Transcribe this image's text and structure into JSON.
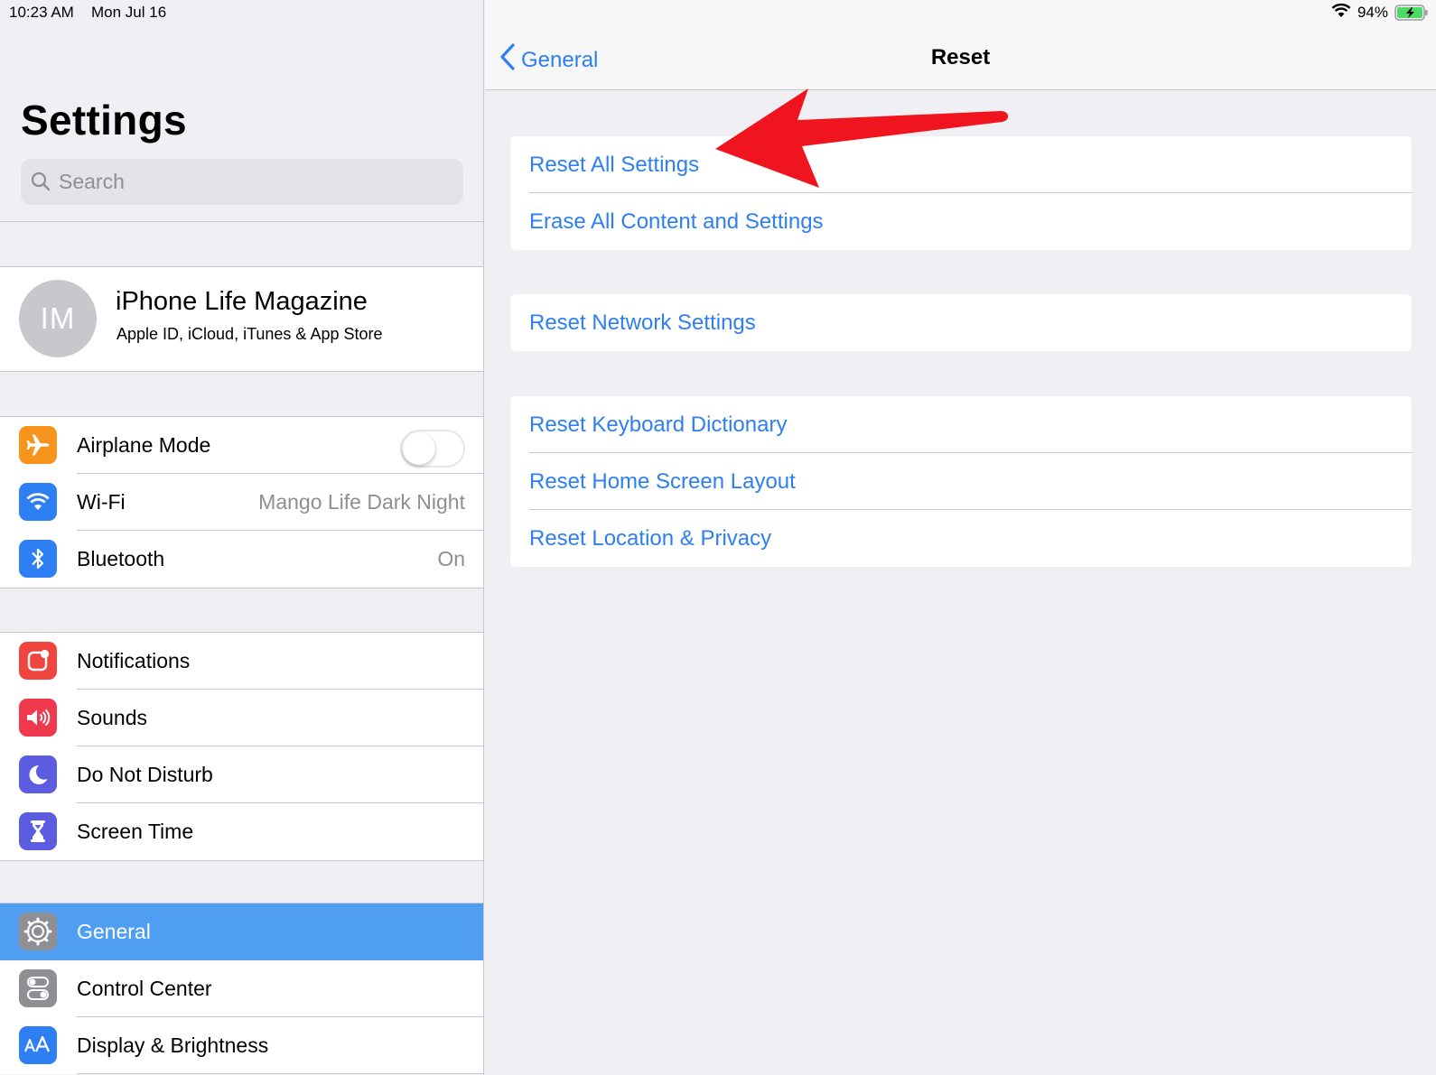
{
  "status_bar": {
    "time": "10:23 AM",
    "date": "Mon Jul 16",
    "battery": "94%"
  },
  "sidebar": {
    "title": "Settings",
    "search_placeholder": "Search",
    "profile": {
      "initials": "IM",
      "name": "iPhone Life Magazine",
      "subtitle": "Apple ID, iCloud, iTunes & App Store"
    },
    "group1": [
      {
        "label": "Airplane Mode",
        "icon": "airplane-icon",
        "color": "#f7941d",
        "toggle": false
      },
      {
        "label": "Wi-Fi",
        "icon": "wifi-icon",
        "color": "#2d7ff3",
        "value": "Mango Life Dark Night"
      },
      {
        "label": "Bluetooth",
        "icon": "bluetooth-icon",
        "color": "#2d7ff3",
        "value": "On"
      }
    ],
    "group2": [
      {
        "label": "Notifications",
        "icon": "notifications-icon",
        "color": "#f0443e"
      },
      {
        "label": "Sounds",
        "icon": "sounds-icon",
        "color": "#f0384f"
      },
      {
        "label": "Do Not Disturb",
        "icon": "moon-icon",
        "color": "#5c5ce0"
      },
      {
        "label": "Screen Time",
        "icon": "hourglass-icon",
        "color": "#5c5ce0"
      }
    ],
    "group3": [
      {
        "label": "General",
        "icon": "gear-icon",
        "color": "#8e8e93",
        "selected": true
      },
      {
        "label": "Control Center",
        "icon": "toggles-icon",
        "color": "#8e8e93"
      },
      {
        "label": "Display & Brightness",
        "icon": "text-size-icon",
        "color": "#2d7ff3"
      }
    ]
  },
  "detail": {
    "back_label": "General",
    "title": "Reset",
    "sections": [
      [
        "Reset All Settings",
        "Erase All Content and Settings"
      ],
      [
        "Reset Network Settings"
      ],
      [
        "Reset Keyboard Dictionary",
        "Reset Home Screen Layout",
        "Reset Location & Privacy"
      ]
    ]
  },
  "colors": {
    "accent": "#2d7ff3",
    "selected_row": "#4f9ef4",
    "annotation_arrow": "#f0141e"
  }
}
